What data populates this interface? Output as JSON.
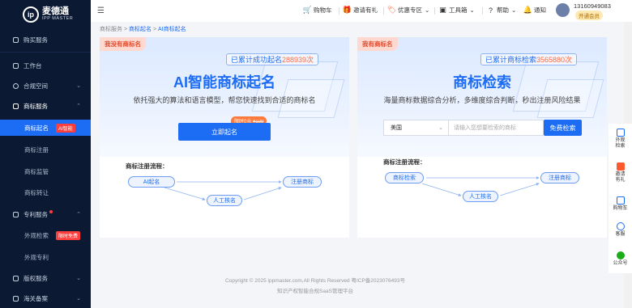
{
  "brand": {
    "logo_mark": "ip",
    "name": "麦德通",
    "sub": "IPP MASTER"
  },
  "sidebar": {
    "items": [
      {
        "label": "购买服务",
        "icon": "shop-icon"
      },
      {
        "label": "工作台",
        "icon": "monitor-icon"
      },
      {
        "label": "合规空间",
        "icon": "shield-icon"
      },
      {
        "label": "商标服务",
        "icon": "trademark-icon"
      },
      {
        "label": "商标起名",
        "badge": "AI智能"
      },
      {
        "label": "商标注册"
      },
      {
        "label": "商标监管"
      },
      {
        "label": "商标转让"
      },
      {
        "label": "专利服务",
        "icon": "patent-icon"
      },
      {
        "label": "外观检索",
        "badge": "限时免费"
      },
      {
        "label": "外观专利"
      },
      {
        "label": "版权服务",
        "icon": "copyright-icon"
      },
      {
        "label": "海关备案",
        "icon": "customs-icon"
      }
    ]
  },
  "header": {
    "cart": "购物车",
    "invite": "邀请有礼",
    "promo": "优惠专区",
    "tools": "工具箱",
    "help": "帮助",
    "notify": "通知",
    "user_phone": "13160949083",
    "user_level": "开通会员"
  },
  "breadcrumb": {
    "a": "商标服务",
    "sep": ">",
    "b": "商标起名",
    "c": "AI商标起名"
  },
  "left_card": {
    "tag": "我没有商标名",
    "counter_prefix": "已累计成功起名",
    "counter_value": "288939次",
    "title": "AI智能商标起名",
    "subtitle": "依托强大的算法和语言模型，帮您快速找到合适的商标名",
    "promo_text": "限时0元",
    "promo_old": "¥199",
    "button": "立即起名",
    "flow_title": "商标注册流程：",
    "steps": [
      "AI起名",
      "人工核名",
      "注册商标"
    ]
  },
  "right_card": {
    "tag": "我有商标名",
    "counter_prefix": "已累计商标检索",
    "counter_value": "3565880次",
    "title": "商标检索",
    "subtitle": "海量商标数据综合分析，多维度综合判断，秒出注册风险结果",
    "country": "美国",
    "search_placeholder": "请输入您想要检索的商标",
    "button": "免费检索",
    "flow_title": "商标注册流程：",
    "steps": [
      "商标检索",
      "人工核名",
      "注册商标"
    ]
  },
  "footer": {
    "copyright": "Copyright © 2025 ippmaster.com,All Rights Reserved 粤ICP备2023076493号",
    "slogan": "知识产权智能合规SaaS管理平台"
  },
  "rail": [
    {
      "label": "外观检索",
      "color": "#1d6cf4"
    },
    {
      "label": "邀请有礼",
      "color": "#ff5a2d"
    },
    {
      "label": "购物车",
      "color": "#1d6cf4"
    },
    {
      "label": "客服",
      "color": "#1d6cf4"
    },
    {
      "label": "公众号",
      "color": "#1aad19"
    }
  ],
  "colors": {
    "primary": "#1d6cf4",
    "sidebar": "#0b1933",
    "accent": "#ff6a3d"
  }
}
